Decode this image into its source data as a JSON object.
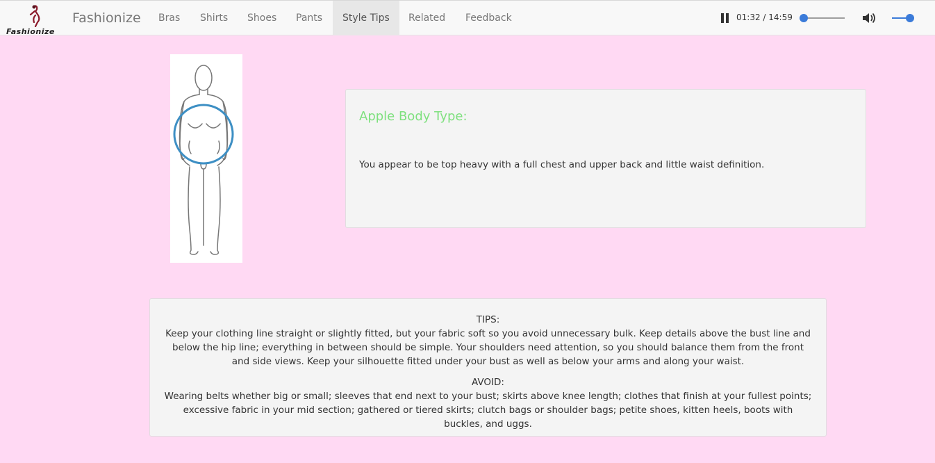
{
  "navbar": {
    "logo_text": "Fashionize",
    "brand": "Fashionize",
    "items": [
      {
        "label": "Bras"
      },
      {
        "label": "Shirts"
      },
      {
        "label": "Shoes"
      },
      {
        "label": "Pants"
      },
      {
        "label": "Style Tips"
      },
      {
        "label": "Related"
      },
      {
        "label": "Feedback"
      }
    ],
    "active_item": "Style Tips"
  },
  "player": {
    "time": "01:32 / 14:59",
    "volume_level": 1.0,
    "icons": [
      "pause-icon",
      "volume-icon"
    ],
    "accent_color": "#3b7bd9"
  },
  "body_type": {
    "title": "Apple Body Type:",
    "description": "You appear to be top heavy with a full chest and upper back and little waist definition.",
    "title_color": "#7ee07e"
  },
  "tips": {
    "tips_heading": "TIPS:",
    "tips_text": "Keep your clothing line straight or slightly fitted, but your fabric soft so you avoid unnecessary bulk. Keep details above the bust line and below the hip line; everything in between should be simple. Your shoulders need attention, so you should balance them from the front and side views. Keep your silhouette fitted under your bust as well as below your arms and along your waist.",
    "avoid_heading": "AVOID:",
    "avoid_text": "Wearing belts whether big or small; sleeves that end next to your bust; skirts above knee length; clothes that finish at your fullest points; excessive fabric in your mid section; gathered or tiered skirts; clutch bags or shoulder bags; petite shoes, kitten heels, boots with buckles, and uggs."
  },
  "colors": {
    "page_background": "#ffd9f3",
    "panel_background": "#f4f4f4"
  }
}
